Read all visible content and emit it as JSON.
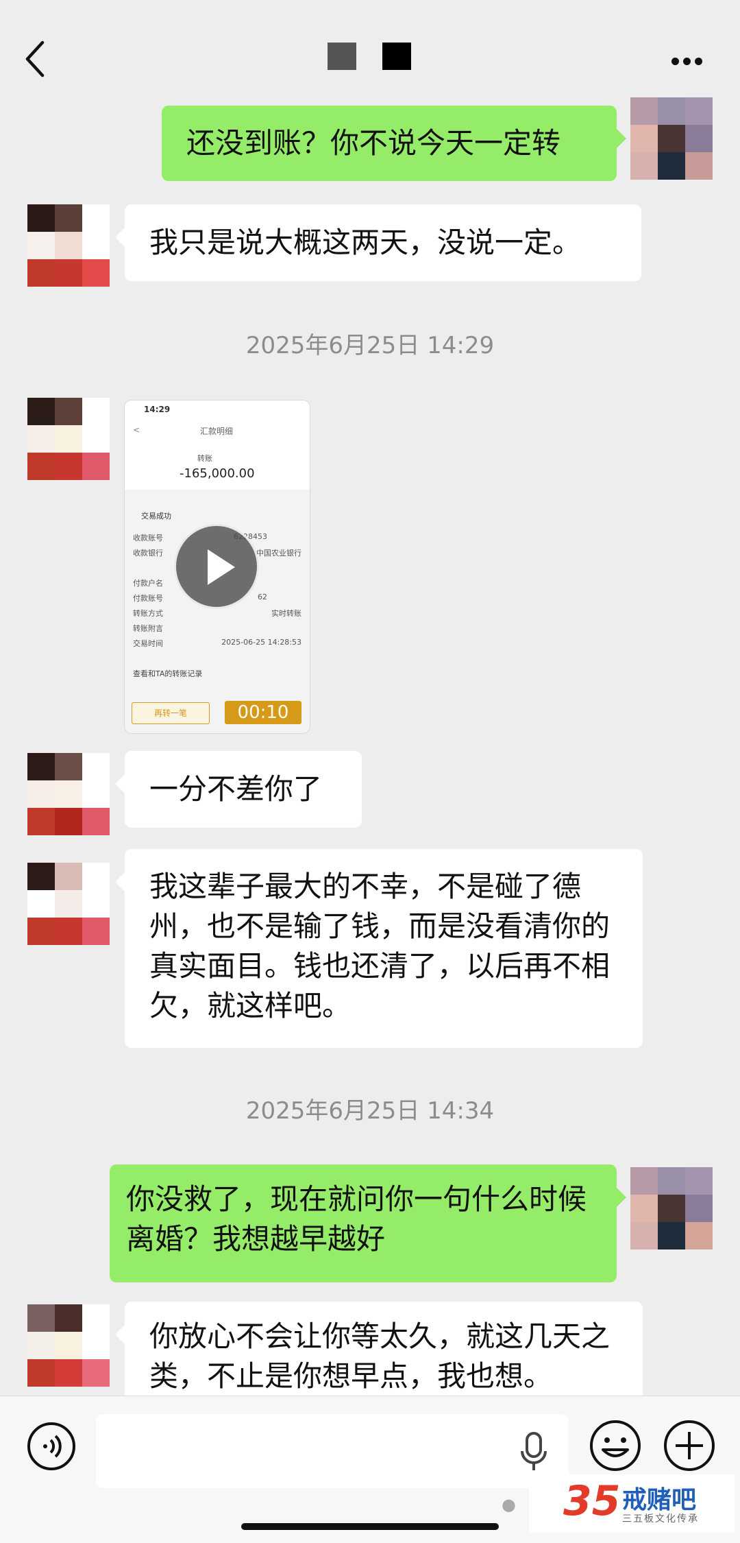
{
  "header": {
    "title_masked": true
  },
  "messages": [
    {
      "side": "me",
      "text": "还没到账？你不说今天一定转"
    },
    {
      "side": "other",
      "text": "我只是说大概这两天，没说一定。"
    },
    {
      "side": "other",
      "text": "一分不差你了"
    },
    {
      "side": "other",
      "text": "我这辈子最大的不幸，不是碰了德州，也不是输了钱，而是没看清你的真实面目。钱也还清了，以后再不相欠，就这样吧。"
    },
    {
      "side": "me",
      "text": "你没救了，现在就问你一句什么时候离婚？我想越早越好"
    },
    {
      "side": "other",
      "text": "你放心不会让你等太久，就这几天之类，不止是你想早点，我也想。"
    }
  ],
  "timestamps": [
    "2025年6月25日 14:29",
    "2025年6月25日 14:34"
  ],
  "video": {
    "time": "14:29",
    "screen_title": "汇款明细",
    "type_label": "转账",
    "amount": "-165,000.00",
    "status": "交易成功",
    "rows": [
      {
        "label": "收款账号",
        "value": "6228453"
      },
      {
        "label": "收款银行",
        "value": "中国农业银行"
      },
      {
        "label": "付款户名",
        "value": ""
      },
      {
        "label": "付款账号",
        "value": "62"
      },
      {
        "label": "转账方式",
        "value": "实时转账"
      },
      {
        "label": "转账附言",
        "value": ""
      },
      {
        "label": "交易时间",
        "value": "2025-06-25 14:28:53"
      }
    ],
    "history_link": "查看和TA的转账记录",
    "again_button": "再转一笔",
    "duration": "00:10"
  },
  "watermark": {
    "number": "35",
    "name": "戒赌吧",
    "slogan": "三五板文化传承",
    "colors": {
      "red": "#e33b2a",
      "blue": "#1f5fb8"
    }
  },
  "icons": [
    "back-icon",
    "more-icon",
    "voice-icon",
    "mic-icon",
    "emoji-icon",
    "plus-icon",
    "play-icon"
  ],
  "colors": {
    "background": "#ededed",
    "my_bubble": "#95ec69",
    "other_bubble": "#ffffff",
    "timestamp": "#8c8c8c"
  }
}
